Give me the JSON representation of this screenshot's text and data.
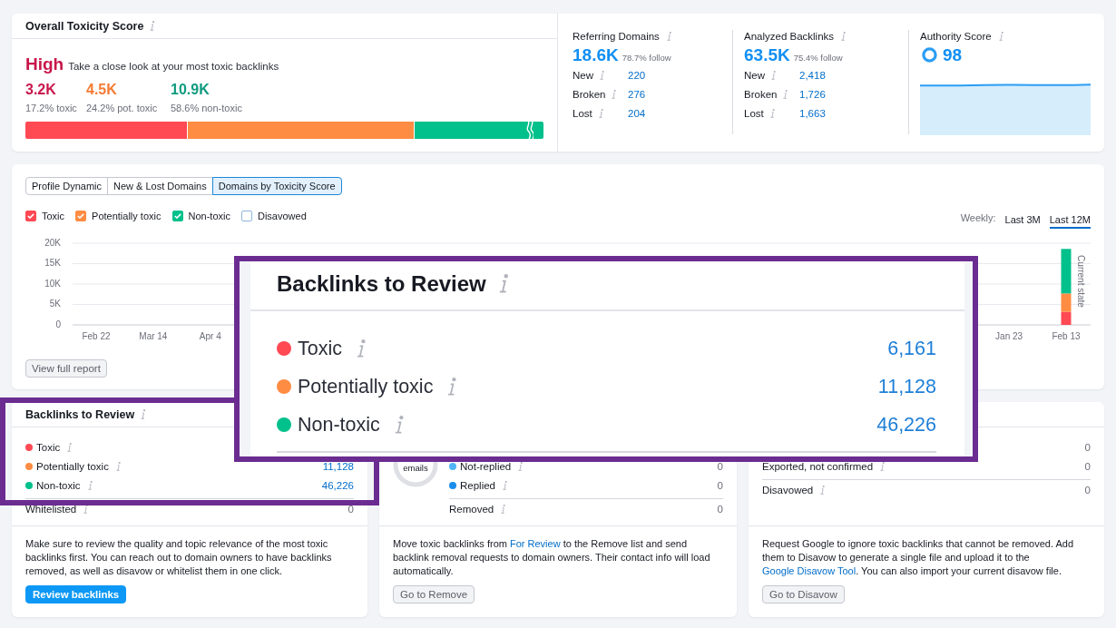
{
  "overall_toxicity": {
    "title": "Overall Toxicity Score",
    "severity_label": "High",
    "message": "Take a close look at your most toxic backlinks",
    "stats": [
      {
        "value": "3.2K",
        "caption": "17.2% toxic",
        "color": "#c8174a"
      },
      {
        "value": "4.5K",
        "caption": "24.2% pot. toxic",
        "color": "#f47b34"
      },
      {
        "value": "10.9K",
        "caption": "58.6% non-toxic",
        "color": "#0f9a7e"
      }
    ],
    "bar": [
      {
        "level": 0.313,
        "color": "#ff4953",
        "broken": false
      },
      {
        "color": "#ff8c43",
        "broken": false
      },
      {
        "level": 0.249,
        "color": "#00c08b",
        "broken": true
      }
    ]
  },
  "metrics": [
    {
      "kind": "counts",
      "title": "Referring Domains",
      "value": "18.6K",
      "note": "78.7% follow",
      "rows": [
        {
          "label": "New",
          "value": "220"
        },
        {
          "label": "Broken",
          "value": "276"
        },
        {
          "label": "Lost",
          "value": "204"
        }
      ]
    },
    {
      "kind": "counts",
      "title": "Analyzed Backlinks",
      "value": "63.5K",
      "note": "75.4% follow",
      "rows": [
        {
          "label": "New",
          "value": "2,418"
        },
        {
          "label": "Broken",
          "value": "1,726"
        },
        {
          "label": "Lost",
          "value": "1,663"
        }
      ]
    },
    {
      "kind": "score",
      "title": "Authority Score",
      "value": "98"
    }
  ],
  "chart_panel": {
    "tabs": [
      {
        "label": "Profile Dynamic",
        "selected": false
      },
      {
        "label": "New & Lost Domains",
        "selected": false
      },
      {
        "label": "Domains by Toxicity Score",
        "selected": true
      }
    ],
    "legend": [
      {
        "checked": true
      },
      {
        "checked": true
      },
      {
        "checked": true
      },
      {
        "checked": false
      }
    ],
    "period_label": "Weekly:",
    "periods": [
      {
        "label": "Last 3M",
        "selected": false
      },
      {
        "label": "Last 12M",
        "selected": true
      }
    ],
    "chart_data": {
      "type": "bar",
      "stacked": true,
      "grid": true,
      "categories": [
        "Feb 22",
        "Mar 14",
        "Apr 4",
        null,
        null,
        null,
        null,
        null,
        null,
        null,
        null,
        null,
        null,
        null,
        null,
        null,
        "Jan 23",
        "Feb 13"
      ],
      "ylim": [
        0,
        20000
      ],
      "yticks": [
        0,
        {
          "value": 5000,
          "label": "5K"
        },
        {
          "value": 10000,
          "label": "10K"
        },
        {
          "value": 15000,
          "label": "15K"
        },
        {
          "value": 20000,
          "label": "20K"
        }
      ],
      "series": [
        {
          "name": "Toxic",
          "color": "#ff4953",
          "values": [
            null,
            null,
            null,
            null,
            null,
            null,
            null,
            null,
            null,
            null,
            null,
            null,
            null,
            null,
            null,
            null,
            null,
            3200
          ]
        },
        {
          "name": "Potentially toxic",
          "color": "#ff8c43",
          "values": [
            null,
            null,
            null,
            null,
            null,
            null,
            null,
            null,
            null,
            null,
            null,
            null,
            null,
            null,
            null,
            null,
            null,
            4500
          ]
        },
        {
          "name": "Non-toxic",
          "color": "#00c08b",
          "values": [
            null,
            null,
            null,
            null,
            null,
            null,
            null,
            null,
            null,
            null,
            null,
            null,
            null,
            null,
            null,
            null,
            null,
            10900
          ]
        },
        {
          "name": "Disavowed",
          "color": "#8fb6de",
          "values": [
            null,
            null,
            null,
            null,
            null,
            null,
            null,
            null,
            null,
            null,
            null,
            null,
            null,
            null,
            null,
            null,
            null,
            null
          ]
        }
      ],
      "annotations": [
        "Current state"
      ]
    },
    "button": "View full report"
  },
  "cards": [
    {
      "kind": "review",
      "title": "Backlinks to Review",
      "rows": [
        {
          "label": "Toxic",
          "color": "#ff4953"
        },
        {
          "label": "Potentially toxic",
          "color": "#ff8c43",
          "value": "11,128",
          "link": true
        },
        {
          "label": "Non-toxic",
          "color": "#00c08b",
          "value": "46,226",
          "link": true
        }
      ],
      "totals": [
        {
          "label": "Whitelisted",
          "value": "0",
          "link": false
        }
      ],
      "description": [
        {
          "kind": "text",
          "text": "Make sure to review the quality and topic relevance of the most toxic backlinks first. You can reach out to domain owners to have backlinks removed, as well as disavow or whitelist them in one click."
        }
      ],
      "button": {
        "label": "Review backlinks",
        "kind": "primary"
      }
    },
    {
      "kind": "remove",
      "ring_caption": "emails",
      "rows": [
        {
          "label": "Not-replied",
          "color": "#4fb5f7",
          "value": "0",
          "link": false
        },
        {
          "label": "Replied",
          "color": "#1a8cec",
          "value": "0",
          "link": false
        }
      ],
      "totals": [
        {
          "label": "Removed",
          "value": "0",
          "link": false
        }
      ],
      "description": [
        {
          "kind": "text",
          "text": "Move toxic backlinks from "
        },
        {
          "kind": "link",
          "text": "For Review"
        },
        {
          "kind": "text",
          "text": " to the Remove list and send backlink removal requests to domain owners. Their contact info will load automatically."
        }
      ],
      "button": {
        "label": "Go to Remove",
        "kind": "secondary"
      }
    },
    {
      "kind": "disavow",
      "rows": [
        {
          "value": "0",
          "link": false
        },
        {
          "label": "Exported, not confirmed",
          "value": "0",
          "link": false
        }
      ],
      "totals": [
        {
          "label": "Disavowed",
          "value": "0",
          "link": false
        }
      ],
      "description": [
        {
          "kind": "text",
          "text": "Request Google to ignore toxic backlinks that cannot be removed. Add them to Disavow to generate a single file and upload it to the "
        },
        {
          "kind": "link",
          "text": "Google Disavow Tool"
        },
        {
          "kind": "text",
          "text": ". You can also import your current disavow file."
        }
      ],
      "button": {
        "label": "Go to Disavow",
        "kind": "secondary"
      }
    }
  ],
  "callout": {
    "title": "Backlinks to Review",
    "rows": [
      {
        "label": "Toxic",
        "color": "#ff4953",
        "value": "6,161"
      },
      {
        "label": "Potentially toxic",
        "color": "#ff8c43",
        "value": "11,128"
      },
      {
        "label": "Non-toxic",
        "color": "#00c08b",
        "value": "46,226"
      }
    ]
  }
}
